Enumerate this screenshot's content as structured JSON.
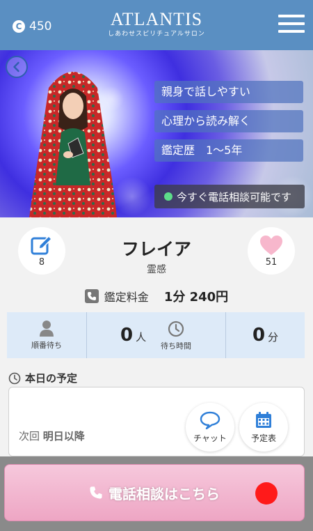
{
  "header": {
    "coin_count": "450",
    "coin_symbol": "C",
    "brand_title": "ATLANTIS",
    "brand_subtitle": "しあわせスピリチュアルサロン"
  },
  "hero": {
    "tags": [
      "親身で話しやすい",
      "心理から読み解く",
      "鑑定歴　1〜5年"
    ],
    "status": "今すぐ電話相談可能です"
  },
  "profile": {
    "name": "フレイア",
    "genre": "霊感",
    "review_count": "8",
    "favorite_count": "51",
    "fee_label": "鑑定料金",
    "fee_value": "1分 240円"
  },
  "stats": {
    "queue_label": "順番待ち",
    "queue_count": "0",
    "queue_unit": "人",
    "wait_label": "待ち時間",
    "wait_minutes": "0",
    "wait_unit": "分"
  },
  "schedule": {
    "heading": "本日の予定",
    "next_label": "次回",
    "next_value": "明日以降",
    "chat_label": "チャット",
    "calendar_label": "予定表"
  },
  "cta": {
    "label": "電話相談はこちら"
  },
  "colors": {
    "header": "#5a8fc2",
    "stats_bg": "#ddeaf8",
    "cta_pink": "#eea6c4",
    "live_red": "#ff1a1a",
    "online_green": "#5ddc8a",
    "accent_blue": "#2f7fd8"
  }
}
